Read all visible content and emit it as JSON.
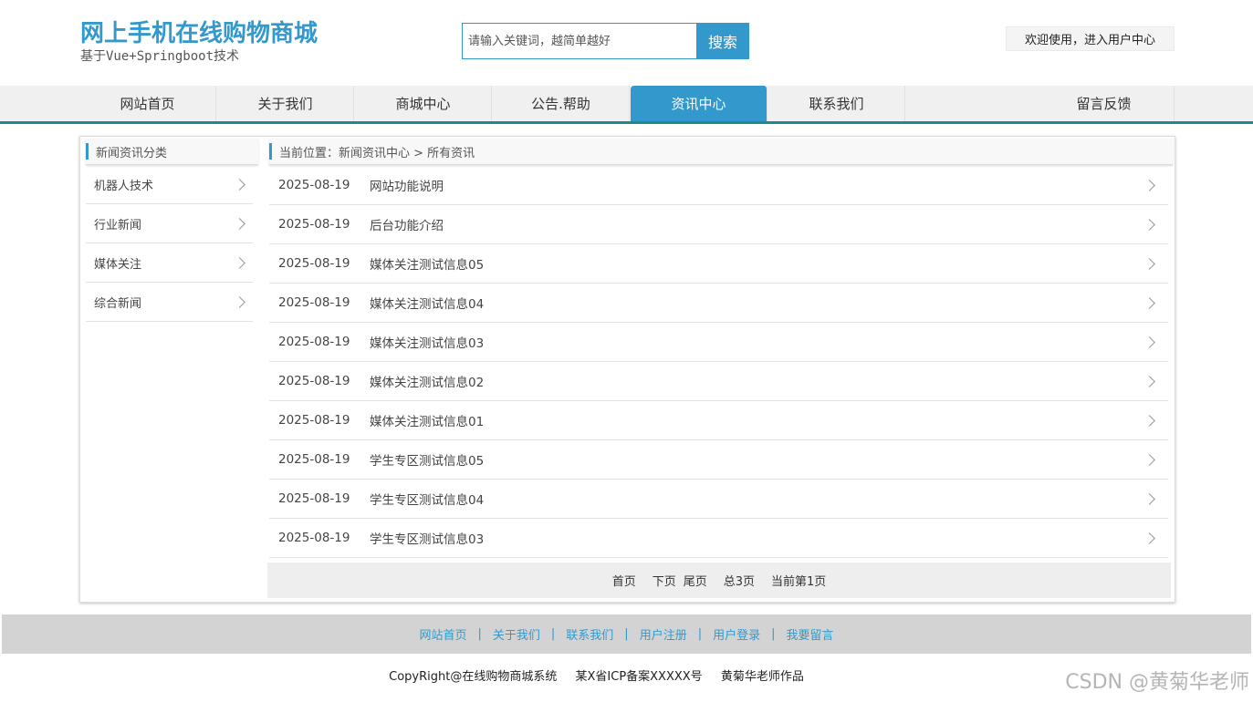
{
  "header": {
    "site_title": "网上手机在线购物商城",
    "subtitle": "基于Vue+Springboot技术",
    "search_placeholder": "请输入关键词，越简单越好",
    "search_button": "搜索",
    "user_center": "欢迎使用，进入用户中心"
  },
  "nav": {
    "items": [
      "网站首页",
      "关于我们",
      "商城中心",
      "公告.帮助",
      "资讯中心",
      "联系我们",
      "留言反馈"
    ],
    "active": "资讯中心"
  },
  "sidebar": {
    "heading": "新闻资讯分类",
    "items": [
      "机器人技术",
      "行业新闻",
      "媒体关注",
      "综合新闻"
    ]
  },
  "breadcrumb": "当前位置：新闻资讯中心 > 所有资讯",
  "news": [
    {
      "date": "2025-08-19",
      "title": "网站功能说明"
    },
    {
      "date": "2025-08-19",
      "title": "后台功能介绍"
    },
    {
      "date": "2025-08-19",
      "title": "媒体关注测试信息05"
    },
    {
      "date": "2025-08-19",
      "title": "媒体关注测试信息04"
    },
    {
      "date": "2025-08-19",
      "title": "媒体关注测试信息03"
    },
    {
      "date": "2025-08-19",
      "title": "媒体关注测试信息02"
    },
    {
      "date": "2025-08-19",
      "title": "媒体关注测试信息01"
    },
    {
      "date": "2025-08-19",
      "title": "学生专区测试信息05"
    },
    {
      "date": "2025-08-19",
      "title": "学生专区测试信息04"
    },
    {
      "date": "2025-08-19",
      "title": "学生专区测试信息03"
    }
  ],
  "pager": {
    "first": "首页",
    "next": "下页",
    "last": "尾页",
    "total": "总3页",
    "current": "当前第1页"
  },
  "footer": {
    "links": [
      "网站首页",
      "关于我们",
      "联系我们",
      "用户注册",
      "用户登录",
      "我要留言"
    ],
    "separator": "|",
    "copyright": "CopyRight@在线购物商城系统",
    "icp": "某X省ICP备案XXXXX号",
    "author": "黄菊华老师作品"
  },
  "watermark": "CSDN @黄菊华老师",
  "colors": {
    "accent": "#3399cc",
    "nav_border": "#1e8a8a"
  }
}
